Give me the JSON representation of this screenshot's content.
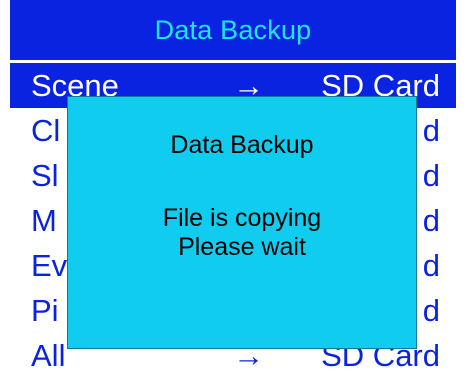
{
  "colors": {
    "title_bg": "#0a23e0",
    "title_text": "#1ee6f0",
    "selected_bg": "#0a23e0",
    "selected_text": "#ffffff",
    "item_text": "#0a23e0",
    "dialog_bg": "#10cdf0",
    "dialog_text": "#000000"
  },
  "header": {
    "title": "Data Backup"
  },
  "menu": {
    "items": [
      {
        "label": "Scene",
        "arrow": "→",
        "target": "SD Card",
        "selected": true
      },
      {
        "label": "Cl",
        "arrow": "",
        "target": "d",
        "selected": false
      },
      {
        "label": "Sl",
        "arrow": "",
        "target": "d",
        "selected": false
      },
      {
        "label": "M",
        "arrow": "",
        "target": "d",
        "selected": false
      },
      {
        "label": "Ev",
        "arrow": "",
        "target": "d",
        "selected": false
      },
      {
        "label": "Pi",
        "arrow": "",
        "target": "d",
        "selected": false
      },
      {
        "label": "All",
        "arrow": "→",
        "target": "SD Card",
        "selected": false
      }
    ]
  },
  "dialog": {
    "title": "Data Backup",
    "line1": "File is copying",
    "line2": "Please wait"
  }
}
